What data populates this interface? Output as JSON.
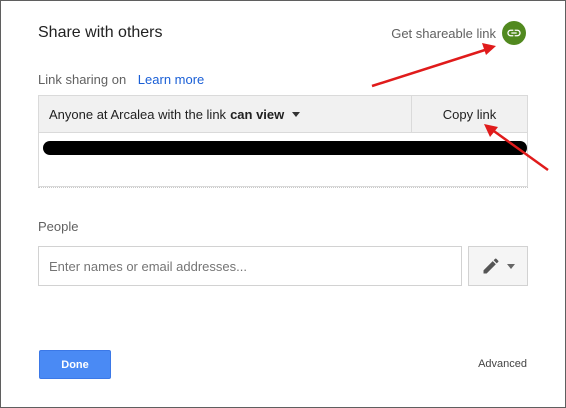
{
  "dialog": {
    "title": "Share with others",
    "get_link_label": "Get shareable link",
    "link_icon": "link-icon",
    "accent_green": "#51891f"
  },
  "link_sharing": {
    "label": "Link sharing on",
    "learn_more": "Learn more",
    "access_prefix": "Anyone at Arcalea with the link",
    "access_level": "can view",
    "copy_label": "Copy link"
  },
  "people": {
    "label": "People",
    "placeholder": "Enter names or email addresses...",
    "permission_icon": "pencil-icon"
  },
  "footer": {
    "done_label": "Done",
    "advanced_label": "Advanced",
    "primary_color": "#4a8af4"
  },
  "annotations": {
    "arrow_color": "#e01b1b"
  }
}
